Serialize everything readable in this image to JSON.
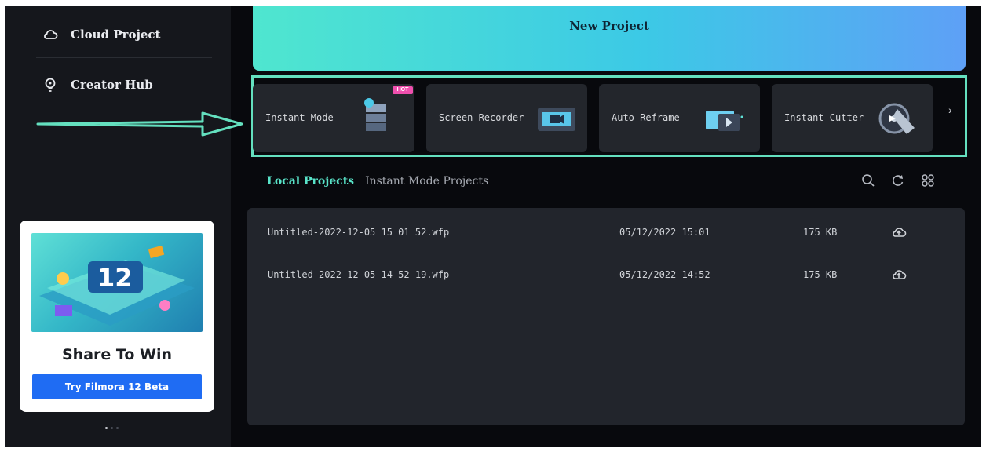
{
  "sidebar": {
    "items": [
      {
        "label": "Cloud Project",
        "icon": "cloud-icon"
      },
      {
        "label": "Creator Hub",
        "icon": "lightbulb-icon"
      }
    ],
    "promo": {
      "title": "Share To Win",
      "button": "Try Filmora 12 Beta",
      "art_text": "12"
    },
    "carousel": {
      "count": 3,
      "active": 1
    }
  },
  "header": {
    "new_project": "New Project"
  },
  "quick_tools": [
    {
      "label": "Instant Mode",
      "badge": "HOT"
    },
    {
      "label": "Screen Recorder"
    },
    {
      "label": "Auto Reframe"
    },
    {
      "label": "Instant Cutter"
    }
  ],
  "projects": {
    "tabs": [
      {
        "label": "Local Projects",
        "active": true
      },
      {
        "label": "Instant Mode Projects",
        "active": false
      }
    ],
    "toolbar_icons": [
      "search-icon",
      "refresh-icon",
      "grid-view-icon"
    ],
    "rows": [
      {
        "name": "Untitled-2022-12-05 15 01 52.wfp",
        "date": "05/12/2022 15:01",
        "size": "175 KB"
      },
      {
        "name": "Untitled-2022-12-05 14 52 19.wfp",
        "date": "05/12/2022 14:52",
        "size": "175 KB"
      }
    ]
  },
  "colors": {
    "accent": "#59e4c9",
    "highlight_border": "#64e0bf",
    "button_blue": "#1f6cf3",
    "background": "#08090d"
  }
}
